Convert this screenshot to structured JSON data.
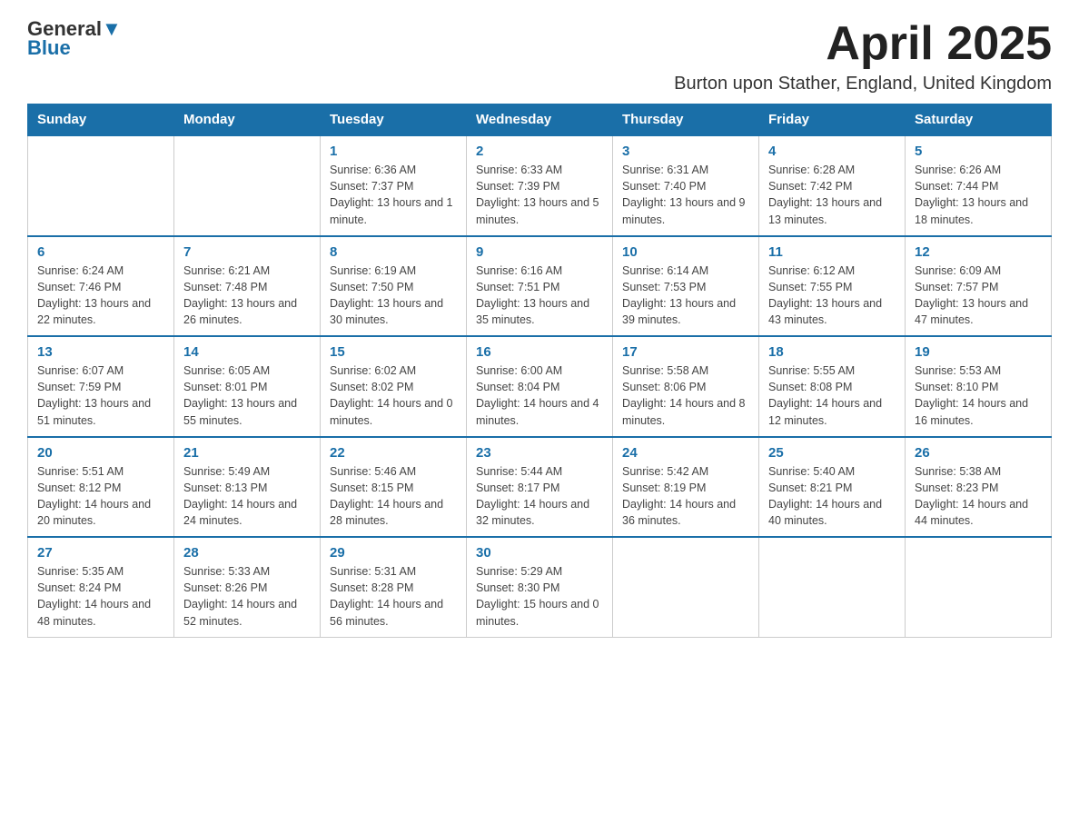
{
  "logo": {
    "line1": "General",
    "line2": "Blue"
  },
  "header": {
    "month": "April 2025",
    "location": "Burton upon Stather, England, United Kingdom"
  },
  "weekdays": [
    "Sunday",
    "Monday",
    "Tuesday",
    "Wednesday",
    "Thursday",
    "Friday",
    "Saturday"
  ],
  "weeks": [
    [
      {
        "day": "",
        "info": ""
      },
      {
        "day": "",
        "info": ""
      },
      {
        "day": "1",
        "info": "Sunrise: 6:36 AM\nSunset: 7:37 PM\nDaylight: 13 hours and 1 minute."
      },
      {
        "day": "2",
        "info": "Sunrise: 6:33 AM\nSunset: 7:39 PM\nDaylight: 13 hours and 5 minutes."
      },
      {
        "day": "3",
        "info": "Sunrise: 6:31 AM\nSunset: 7:40 PM\nDaylight: 13 hours and 9 minutes."
      },
      {
        "day": "4",
        "info": "Sunrise: 6:28 AM\nSunset: 7:42 PM\nDaylight: 13 hours and 13 minutes."
      },
      {
        "day": "5",
        "info": "Sunrise: 6:26 AM\nSunset: 7:44 PM\nDaylight: 13 hours and 18 minutes."
      }
    ],
    [
      {
        "day": "6",
        "info": "Sunrise: 6:24 AM\nSunset: 7:46 PM\nDaylight: 13 hours and 22 minutes."
      },
      {
        "day": "7",
        "info": "Sunrise: 6:21 AM\nSunset: 7:48 PM\nDaylight: 13 hours and 26 minutes."
      },
      {
        "day": "8",
        "info": "Sunrise: 6:19 AM\nSunset: 7:50 PM\nDaylight: 13 hours and 30 minutes."
      },
      {
        "day": "9",
        "info": "Sunrise: 6:16 AM\nSunset: 7:51 PM\nDaylight: 13 hours and 35 minutes."
      },
      {
        "day": "10",
        "info": "Sunrise: 6:14 AM\nSunset: 7:53 PM\nDaylight: 13 hours and 39 minutes."
      },
      {
        "day": "11",
        "info": "Sunrise: 6:12 AM\nSunset: 7:55 PM\nDaylight: 13 hours and 43 minutes."
      },
      {
        "day": "12",
        "info": "Sunrise: 6:09 AM\nSunset: 7:57 PM\nDaylight: 13 hours and 47 minutes."
      }
    ],
    [
      {
        "day": "13",
        "info": "Sunrise: 6:07 AM\nSunset: 7:59 PM\nDaylight: 13 hours and 51 minutes."
      },
      {
        "day": "14",
        "info": "Sunrise: 6:05 AM\nSunset: 8:01 PM\nDaylight: 13 hours and 55 minutes."
      },
      {
        "day": "15",
        "info": "Sunrise: 6:02 AM\nSunset: 8:02 PM\nDaylight: 14 hours and 0 minutes."
      },
      {
        "day": "16",
        "info": "Sunrise: 6:00 AM\nSunset: 8:04 PM\nDaylight: 14 hours and 4 minutes."
      },
      {
        "day": "17",
        "info": "Sunrise: 5:58 AM\nSunset: 8:06 PM\nDaylight: 14 hours and 8 minutes."
      },
      {
        "day": "18",
        "info": "Sunrise: 5:55 AM\nSunset: 8:08 PM\nDaylight: 14 hours and 12 minutes."
      },
      {
        "day": "19",
        "info": "Sunrise: 5:53 AM\nSunset: 8:10 PM\nDaylight: 14 hours and 16 minutes."
      }
    ],
    [
      {
        "day": "20",
        "info": "Sunrise: 5:51 AM\nSunset: 8:12 PM\nDaylight: 14 hours and 20 minutes."
      },
      {
        "day": "21",
        "info": "Sunrise: 5:49 AM\nSunset: 8:13 PM\nDaylight: 14 hours and 24 minutes."
      },
      {
        "day": "22",
        "info": "Sunrise: 5:46 AM\nSunset: 8:15 PM\nDaylight: 14 hours and 28 minutes."
      },
      {
        "day": "23",
        "info": "Sunrise: 5:44 AM\nSunset: 8:17 PM\nDaylight: 14 hours and 32 minutes."
      },
      {
        "day": "24",
        "info": "Sunrise: 5:42 AM\nSunset: 8:19 PM\nDaylight: 14 hours and 36 minutes."
      },
      {
        "day": "25",
        "info": "Sunrise: 5:40 AM\nSunset: 8:21 PM\nDaylight: 14 hours and 40 minutes."
      },
      {
        "day": "26",
        "info": "Sunrise: 5:38 AM\nSunset: 8:23 PM\nDaylight: 14 hours and 44 minutes."
      }
    ],
    [
      {
        "day": "27",
        "info": "Sunrise: 5:35 AM\nSunset: 8:24 PM\nDaylight: 14 hours and 48 minutes."
      },
      {
        "day": "28",
        "info": "Sunrise: 5:33 AM\nSunset: 8:26 PM\nDaylight: 14 hours and 52 minutes."
      },
      {
        "day": "29",
        "info": "Sunrise: 5:31 AM\nSunset: 8:28 PM\nDaylight: 14 hours and 56 minutes."
      },
      {
        "day": "30",
        "info": "Sunrise: 5:29 AM\nSunset: 8:30 PM\nDaylight: 15 hours and 0 minutes."
      },
      {
        "day": "",
        "info": ""
      },
      {
        "day": "",
        "info": ""
      },
      {
        "day": "",
        "info": ""
      }
    ]
  ]
}
